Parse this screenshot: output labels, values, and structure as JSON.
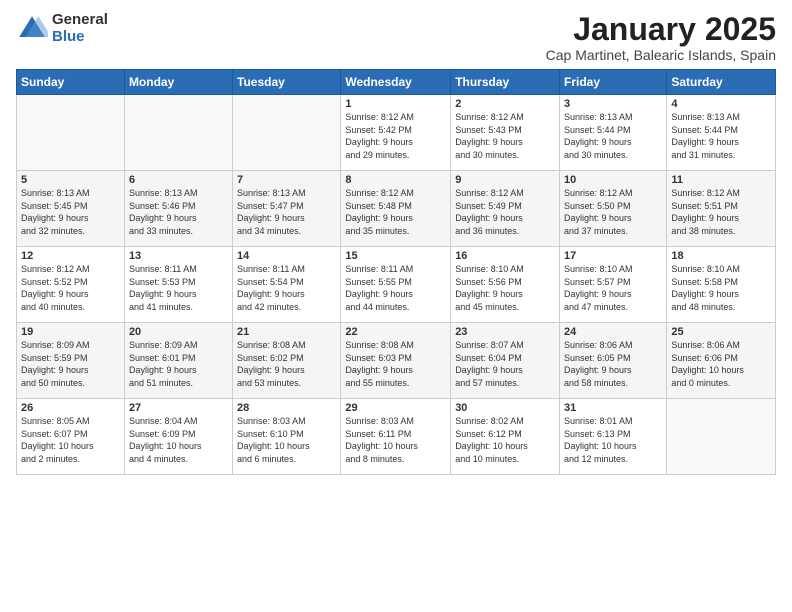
{
  "logo": {
    "general": "General",
    "blue": "Blue"
  },
  "title": {
    "month": "January 2025",
    "location": "Cap Martinet, Balearic Islands, Spain"
  },
  "weekdays": [
    "Sunday",
    "Monday",
    "Tuesday",
    "Wednesday",
    "Thursday",
    "Friday",
    "Saturday"
  ],
  "weeks": [
    [
      {
        "day": "",
        "info": ""
      },
      {
        "day": "",
        "info": ""
      },
      {
        "day": "",
        "info": ""
      },
      {
        "day": "1",
        "info": "Sunrise: 8:12 AM\nSunset: 5:42 PM\nDaylight: 9 hours\nand 29 minutes."
      },
      {
        "day": "2",
        "info": "Sunrise: 8:12 AM\nSunset: 5:43 PM\nDaylight: 9 hours\nand 30 minutes."
      },
      {
        "day": "3",
        "info": "Sunrise: 8:13 AM\nSunset: 5:44 PM\nDaylight: 9 hours\nand 30 minutes."
      },
      {
        "day": "4",
        "info": "Sunrise: 8:13 AM\nSunset: 5:44 PM\nDaylight: 9 hours\nand 31 minutes."
      }
    ],
    [
      {
        "day": "5",
        "info": "Sunrise: 8:13 AM\nSunset: 5:45 PM\nDaylight: 9 hours\nand 32 minutes."
      },
      {
        "day": "6",
        "info": "Sunrise: 8:13 AM\nSunset: 5:46 PM\nDaylight: 9 hours\nand 33 minutes."
      },
      {
        "day": "7",
        "info": "Sunrise: 8:13 AM\nSunset: 5:47 PM\nDaylight: 9 hours\nand 34 minutes."
      },
      {
        "day": "8",
        "info": "Sunrise: 8:12 AM\nSunset: 5:48 PM\nDaylight: 9 hours\nand 35 minutes."
      },
      {
        "day": "9",
        "info": "Sunrise: 8:12 AM\nSunset: 5:49 PM\nDaylight: 9 hours\nand 36 minutes."
      },
      {
        "day": "10",
        "info": "Sunrise: 8:12 AM\nSunset: 5:50 PM\nDaylight: 9 hours\nand 37 minutes."
      },
      {
        "day": "11",
        "info": "Sunrise: 8:12 AM\nSunset: 5:51 PM\nDaylight: 9 hours\nand 38 minutes."
      }
    ],
    [
      {
        "day": "12",
        "info": "Sunrise: 8:12 AM\nSunset: 5:52 PM\nDaylight: 9 hours\nand 40 minutes."
      },
      {
        "day": "13",
        "info": "Sunrise: 8:11 AM\nSunset: 5:53 PM\nDaylight: 9 hours\nand 41 minutes."
      },
      {
        "day": "14",
        "info": "Sunrise: 8:11 AM\nSunset: 5:54 PM\nDaylight: 9 hours\nand 42 minutes."
      },
      {
        "day": "15",
        "info": "Sunrise: 8:11 AM\nSunset: 5:55 PM\nDaylight: 9 hours\nand 44 minutes."
      },
      {
        "day": "16",
        "info": "Sunrise: 8:10 AM\nSunset: 5:56 PM\nDaylight: 9 hours\nand 45 minutes."
      },
      {
        "day": "17",
        "info": "Sunrise: 8:10 AM\nSunset: 5:57 PM\nDaylight: 9 hours\nand 47 minutes."
      },
      {
        "day": "18",
        "info": "Sunrise: 8:10 AM\nSunset: 5:58 PM\nDaylight: 9 hours\nand 48 minutes."
      }
    ],
    [
      {
        "day": "19",
        "info": "Sunrise: 8:09 AM\nSunset: 5:59 PM\nDaylight: 9 hours\nand 50 minutes."
      },
      {
        "day": "20",
        "info": "Sunrise: 8:09 AM\nSunset: 6:01 PM\nDaylight: 9 hours\nand 51 minutes."
      },
      {
        "day": "21",
        "info": "Sunrise: 8:08 AM\nSunset: 6:02 PM\nDaylight: 9 hours\nand 53 minutes."
      },
      {
        "day": "22",
        "info": "Sunrise: 8:08 AM\nSunset: 6:03 PM\nDaylight: 9 hours\nand 55 minutes."
      },
      {
        "day": "23",
        "info": "Sunrise: 8:07 AM\nSunset: 6:04 PM\nDaylight: 9 hours\nand 57 minutes."
      },
      {
        "day": "24",
        "info": "Sunrise: 8:06 AM\nSunset: 6:05 PM\nDaylight: 9 hours\nand 58 minutes."
      },
      {
        "day": "25",
        "info": "Sunrise: 8:06 AM\nSunset: 6:06 PM\nDaylight: 10 hours\nand 0 minutes."
      }
    ],
    [
      {
        "day": "26",
        "info": "Sunrise: 8:05 AM\nSunset: 6:07 PM\nDaylight: 10 hours\nand 2 minutes."
      },
      {
        "day": "27",
        "info": "Sunrise: 8:04 AM\nSunset: 6:09 PM\nDaylight: 10 hours\nand 4 minutes."
      },
      {
        "day": "28",
        "info": "Sunrise: 8:03 AM\nSunset: 6:10 PM\nDaylight: 10 hours\nand 6 minutes."
      },
      {
        "day": "29",
        "info": "Sunrise: 8:03 AM\nSunset: 6:11 PM\nDaylight: 10 hours\nand 8 minutes."
      },
      {
        "day": "30",
        "info": "Sunrise: 8:02 AM\nSunset: 6:12 PM\nDaylight: 10 hours\nand 10 minutes."
      },
      {
        "day": "31",
        "info": "Sunrise: 8:01 AM\nSunset: 6:13 PM\nDaylight: 10 hours\nand 12 minutes."
      },
      {
        "day": "",
        "info": ""
      }
    ]
  ]
}
